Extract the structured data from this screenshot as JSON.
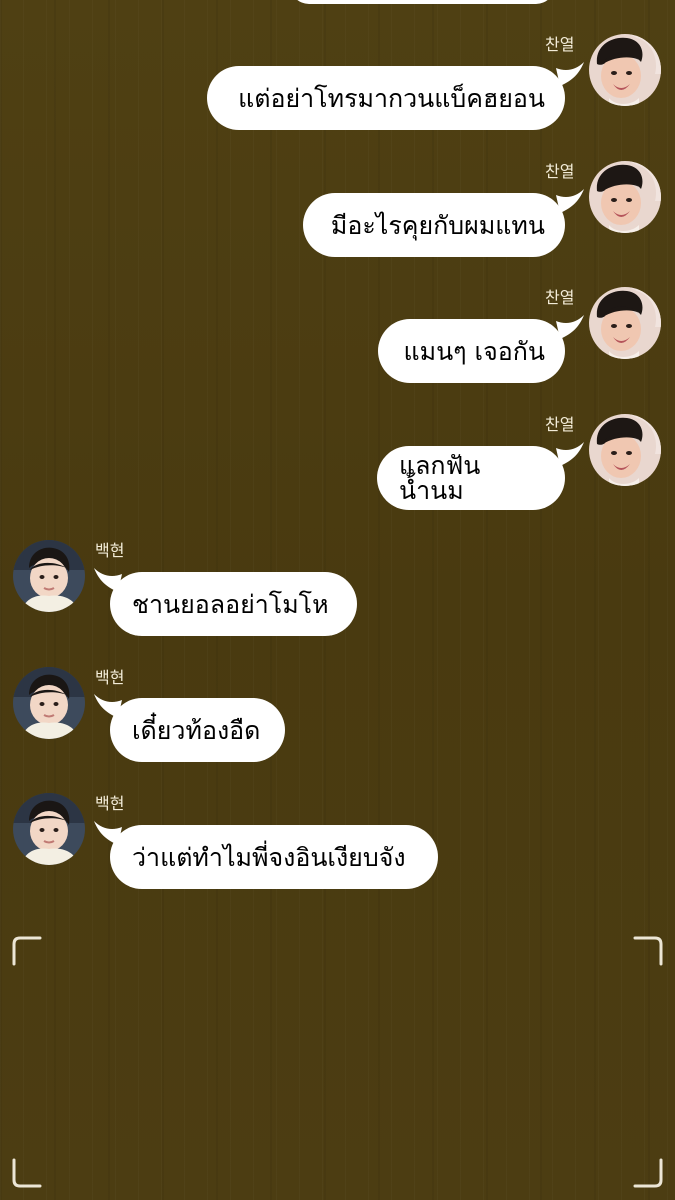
{
  "chat": {
    "user_right": {
      "name": "찬열"
    },
    "user_left": {
      "name": "백현"
    },
    "messages": [
      {
        "sender": "찬열",
        "side": "right",
        "text": "แต่อย่าโทรมากวนแบ็คฮยอน"
      },
      {
        "sender": "찬열",
        "side": "right",
        "text": "มีอะไรคุยกับผมแทน"
      },
      {
        "sender": "찬열",
        "side": "right",
        "text": "แมนๆ เจอกัน"
      },
      {
        "sender": "찬열",
        "side": "right",
        "text": "แลกฟันน้ำนม"
      },
      {
        "sender": "백현",
        "side": "left",
        "text": "ชานยอลอย่าโมโห"
      },
      {
        "sender": "백현",
        "side": "left",
        "text": "เดี๋ยวท้องอืด"
      },
      {
        "sender": "백현",
        "side": "left",
        "text": "ว่าแต่ทำไมพี่จงอินเงียบจัง"
      }
    ]
  },
  "colors": {
    "background": "#4b3d12",
    "bubble": "#ffffff",
    "name_text": "#f3ecd8",
    "corner_marks": "#ece6d6"
  }
}
